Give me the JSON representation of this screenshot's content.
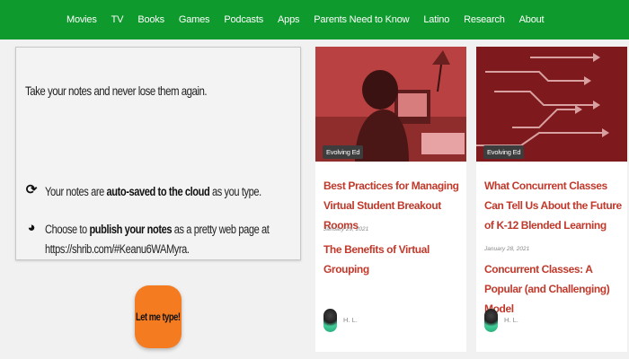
{
  "nav": {
    "items": [
      "Movies",
      "TV",
      "Books",
      "Games",
      "Podcasts",
      "Apps",
      "Parents Need to Know",
      "Latino",
      "Research",
      "About"
    ]
  },
  "notes": {
    "lead": "Take your notes and never lose them again.",
    "autosave_pre": "Your notes are ",
    "autosave_bold": "auto-saved to the cloud",
    "autosave_post": " as you type.",
    "publish_pre": "Choose to ",
    "publish_bold": "publish your notes",
    "publish_post": " as a pretty web page at",
    "publish_url": "https://shrib.com/#Keanu6WAMyra.",
    "button_label": "Let me type!"
  },
  "cards": [
    {
      "badge": "Evolving Ed",
      "title": "Best Practices for Managing Virtual Student Breakout Rooms",
      "date": "January 29, 2021",
      "related": "The Benefits of Virtual Grouping",
      "author": "H. L."
    },
    {
      "badge": "Evolving Ed",
      "title": "What Concurrent Classes Can Tell Us About the Future of K-12 Blended Learning",
      "date": "January 28, 2021",
      "related": "Concurrent Classes: A Popular (and Challenging) Model",
      "author": "H. L."
    }
  ],
  "colors": {
    "nav_bg": "#0e9a2c",
    "title_red": "#c0392b",
    "button_orange": "#f47b20",
    "badge_bg": "#3d3d3d"
  },
  "icons": {
    "autosave": "sync-icon",
    "publish": "globe-icon"
  }
}
